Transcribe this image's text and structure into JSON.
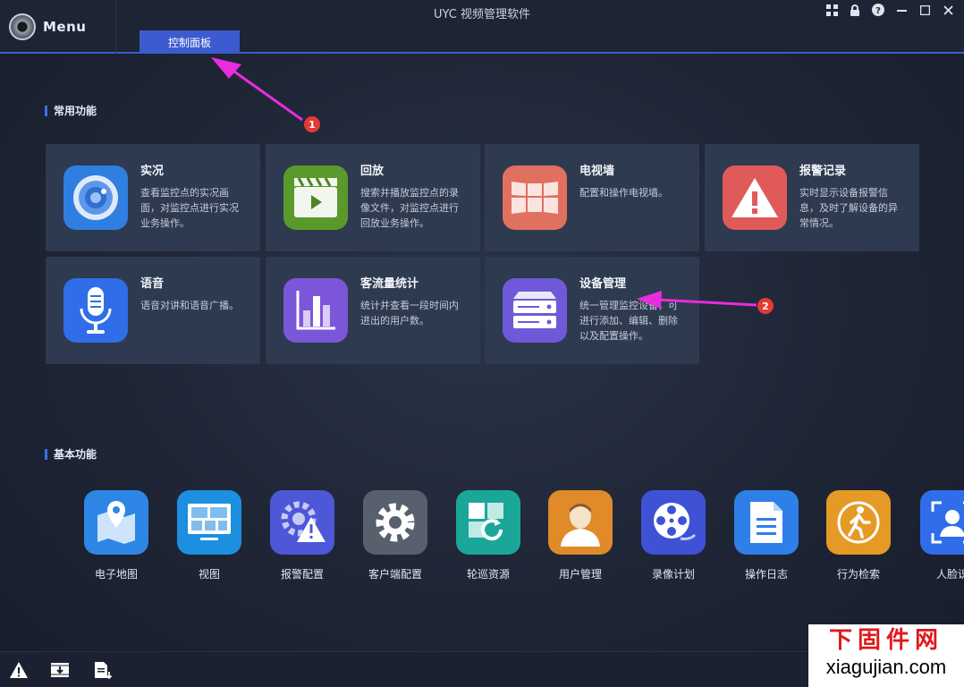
{
  "header": {
    "menu_label": "Menu",
    "app_title": "UYC 视频管理软件",
    "active_tab": "控制面板"
  },
  "sections": {
    "common": "常用功能",
    "basic": "基本功能"
  },
  "cards": [
    {
      "title": "实况",
      "desc": "查看监控点的实况画面，对监控点进行实况业务操作。",
      "icon": "live-camera-icon",
      "color": "#2f7fe0"
    },
    {
      "title": "回放",
      "desc": "搜索并播放监控点的录像文件，对监控点进行回放业务操作。",
      "icon": "clapperboard-icon",
      "color": "#5a9a2c"
    },
    {
      "title": "电视墙",
      "desc": "配置和操作电视墙。",
      "icon": "video-wall-icon",
      "color": "#e0705f"
    },
    {
      "title": "报警记录",
      "desc": "实时显示设备报警信息，及时了解设备的异常情况。",
      "icon": "alarm-warning-icon",
      "color": "#e15a5a"
    },
    {
      "title": "语音",
      "desc": "语音对讲和语音广播。",
      "icon": "microphone-icon",
      "color": "#2f6ee8"
    },
    {
      "title": "客流量统计",
      "desc": "统计并查看一段时间内进出的用户数。",
      "icon": "bar-chart-icon",
      "color": "#7c56d8"
    },
    {
      "title": "设备管理",
      "desc": "统一管理监控设备，可进行添加、编辑、删除以及配置操作。",
      "icon": "device-server-icon",
      "color": "#6e5ad8"
    }
  ],
  "tools": [
    {
      "label": "电子地图",
      "icon": "map-pin-icon",
      "color": "#2d86e6"
    },
    {
      "label": "视图",
      "icon": "monitor-view-icon",
      "color": "#1c8fe0"
    },
    {
      "label": "报警配置",
      "icon": "alarm-config-icon",
      "color": "#4e57d8"
    },
    {
      "label": "客户端配置",
      "icon": "gear-icon",
      "color": "#58606e"
    },
    {
      "label": "轮巡资源",
      "icon": "patrol-resource-icon",
      "color": "#1aa79a"
    },
    {
      "label": "用户管理",
      "icon": "user-icon",
      "color": "#e08a2a"
    },
    {
      "label": "录像计划",
      "icon": "film-reel-icon",
      "color": "#3f52d6"
    },
    {
      "label": "操作日志",
      "icon": "document-log-icon",
      "color": "#2f7fe8"
    },
    {
      "label": "行为检索",
      "icon": "walking-person-icon",
      "color": "#e59a25"
    },
    {
      "label": "人脸识",
      "icon": "face-recognition-icon",
      "color": "#2f6ee8"
    }
  ],
  "annotations": {
    "badge1": "1",
    "badge2": "2",
    "arrow_color": "#e92ce0"
  },
  "watermark": {
    "top": "下固件网",
    "bottom": "xiagujian.com"
  }
}
